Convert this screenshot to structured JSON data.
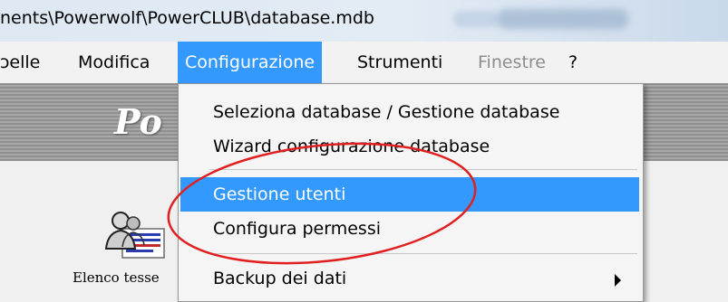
{
  "window": {
    "title": "nents\\Powerwolf\\PowerCLUB\\database.mdb"
  },
  "menubar": {
    "items": [
      {
        "label": "ɔelle"
      },
      {
        "label": "Modifica"
      },
      {
        "label": "Configurazione"
      },
      {
        "label": "Strumenti"
      },
      {
        "label": "Finestre"
      },
      {
        "label": "?"
      }
    ]
  },
  "banner": {
    "text": "Po"
  },
  "tile": {
    "label": "Elenco tesse"
  },
  "dropdown": {
    "items": [
      {
        "label": "Seleziona database / Gestione database"
      },
      {
        "label": "Wizard configurazione database"
      },
      {
        "label": "Gestione utenti"
      },
      {
        "label": "Configura permessi"
      },
      {
        "label": "Backup dei dati"
      }
    ]
  },
  "colors": {
    "highlight": "#3399ff",
    "annotation": "#e02020"
  }
}
